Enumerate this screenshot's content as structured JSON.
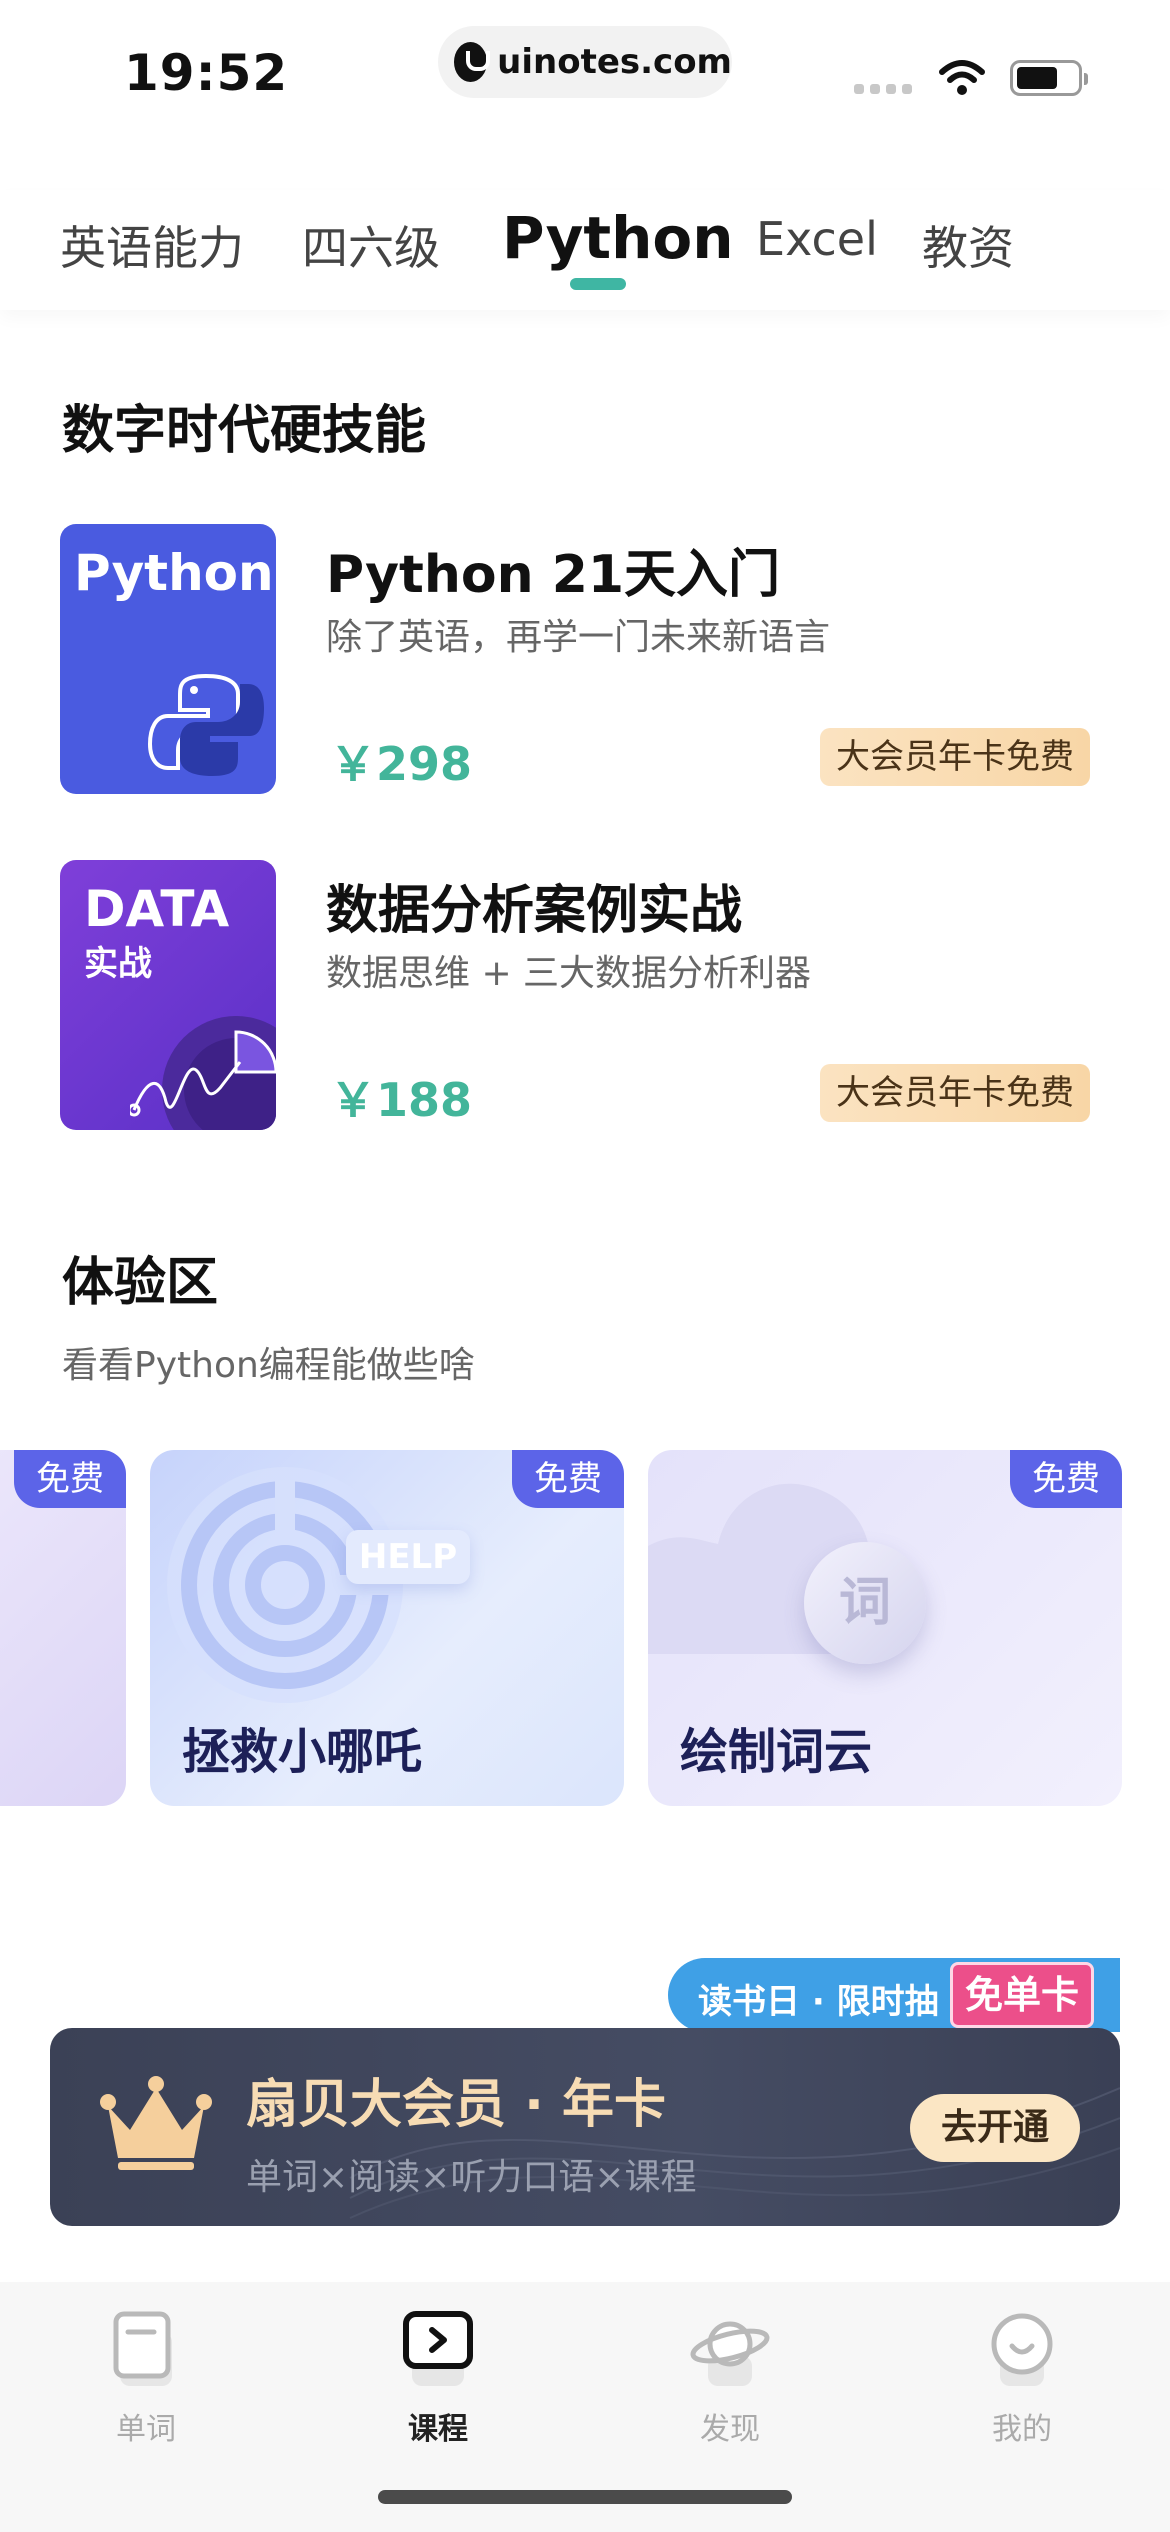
{
  "status_bar": {
    "time": "19:52",
    "url": "uinotes.com",
    "icons": [
      "signal-icon",
      "wifi-icon",
      "battery-icon"
    ]
  },
  "tabs": [
    {
      "label": "英语能力",
      "active": false
    },
    {
      "label": "四六级",
      "active": false
    },
    {
      "label": "Python",
      "active": true
    },
    {
      "label": "Excel",
      "active": false
    },
    {
      "label": "教资",
      "active": false
    }
  ],
  "skills_section": {
    "title": "数字时代硬技能",
    "courses": [
      {
        "thumb_title": "Python",
        "title": "Python 21天入门",
        "desc": "除了英语，再学一门未来新语言",
        "price": "￥298",
        "badge": "大会员年卡免费"
      },
      {
        "thumb_title": "DATA",
        "thumb_sub": "实战",
        "title": "数据分析案例实战",
        "desc": "数据思维 + 三大数据分析利器",
        "price": "￥188",
        "badge": "大会员年卡免费"
      }
    ]
  },
  "experience_section": {
    "title": "体验区",
    "subtitle": "看看Python编程能做些啥",
    "cards": [
      {
        "free": "免费",
        "title": ""
      },
      {
        "free": "免费",
        "title": "拯救小哪吒",
        "decor_text": "HELP"
      },
      {
        "free": "免费",
        "title": "绘制词云",
        "decor_text": "词"
      }
    ]
  },
  "promo": {
    "tag": "读书日 · 限时抽",
    "hot": "免单卡",
    "vip_title": "扇贝大会员 · 年卡",
    "vip_sub": "单词×阅读×听力口语×课程",
    "vip_button": "去开通"
  },
  "bottom_nav": [
    {
      "label": "单词",
      "icon": "book-icon",
      "active": false
    },
    {
      "label": "课程",
      "icon": "play-course-icon",
      "active": true
    },
    {
      "label": "发现",
      "icon": "planet-icon",
      "active": false
    },
    {
      "label": "我的",
      "icon": "smile-face-icon",
      "active": false
    }
  ],
  "colors": {
    "accent": "#3fb6a3",
    "price": "#43b59a",
    "free_badge": "#5c64e8",
    "vip_gold": "#f7dcb4"
  }
}
